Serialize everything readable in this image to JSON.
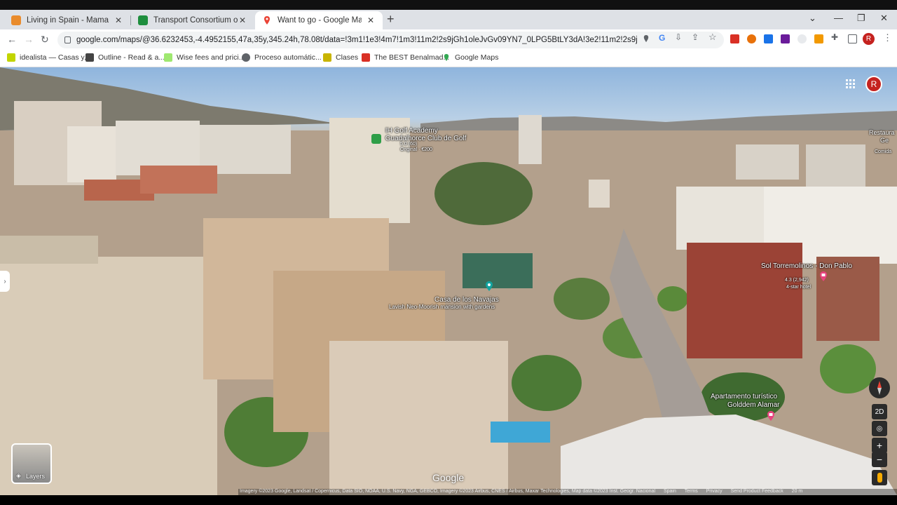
{
  "browser": {
    "tabs": [
      {
        "title": "Living in Spain - Mama Málaga",
        "favicon_color": "#e98b2c"
      },
      {
        "title": "Transport Consortium of Andalu",
        "favicon_color": "#1e8e3e"
      },
      {
        "title": "Want to go - Google Maps",
        "favicon_color": "#ea4335",
        "active": true
      }
    ],
    "url": "google.com/maps/@36.6232453,-4.4952155,47a,35y,345.24h,78.08t/data=!3m1!1e3!4m7!1m3!11m2!2s9jGh1oleJvGv09YN7_0LPG5BtLY3dA!3e2!11m2!2s9jGh1oleJvGv09YN...",
    "profile_initial": "R",
    "bookmarks": [
      {
        "label": "idealista — Casas y...",
        "icon_color": "#c2d500"
      },
      {
        "label": "Outline - Read & a...",
        "icon_color": "#444444"
      },
      {
        "label": "Wise fees and prici...",
        "icon_color": "#9fe870"
      },
      {
        "label": "Proceso automátic...",
        "icon_color": "#5f6368"
      },
      {
        "label": "Clases",
        "icon_color": "#c8b400"
      },
      {
        "label": "The BEST Benalmad...",
        "icon_color": "#d93025"
      },
      {
        "label": "Google Maps",
        "icon_color": "#34a853"
      }
    ]
  },
  "map": {
    "profile_initial": "R",
    "places": [
      {
        "name": "IH Golf Academy Guadalhorce Club de Golf",
        "sub1": "5.0 (60)",
        "sub2": "Original · €200"
      },
      {
        "name": "Casa de los Navajas",
        "sub1": "Lavish Neo-Moorish mansion with gardens"
      },
      {
        "name": "Sol Torremolinos - Don Pablo",
        "sub1": "4.3 (2,942)",
        "sub2": "4-star hotel"
      },
      {
        "name": "Apartamento turístico",
        "sub1": "Golddem Alamar"
      },
      {
        "name": "Restaura",
        "sub1": "Ge",
        "sub2": "Comida"
      }
    ],
    "layers_label": "Layers",
    "logo": "Google",
    "controls": {
      "mode_2d": "2D"
    },
    "attribution": {
      "imagery": "Imagery ©2023 Google, Landsat / Copernicus, Data SIO, NOAA, U.S. Navy, NGA, GEBCO, Imagery ©2023 Airbus, CNES / Airbus, Maxar Technologies, Map data ©2023 Inst. Geogr. Nacional",
      "links": [
        "Spain",
        "Terms",
        "Privacy",
        "Send Product Feedback"
      ],
      "scale": "20 m"
    }
  }
}
